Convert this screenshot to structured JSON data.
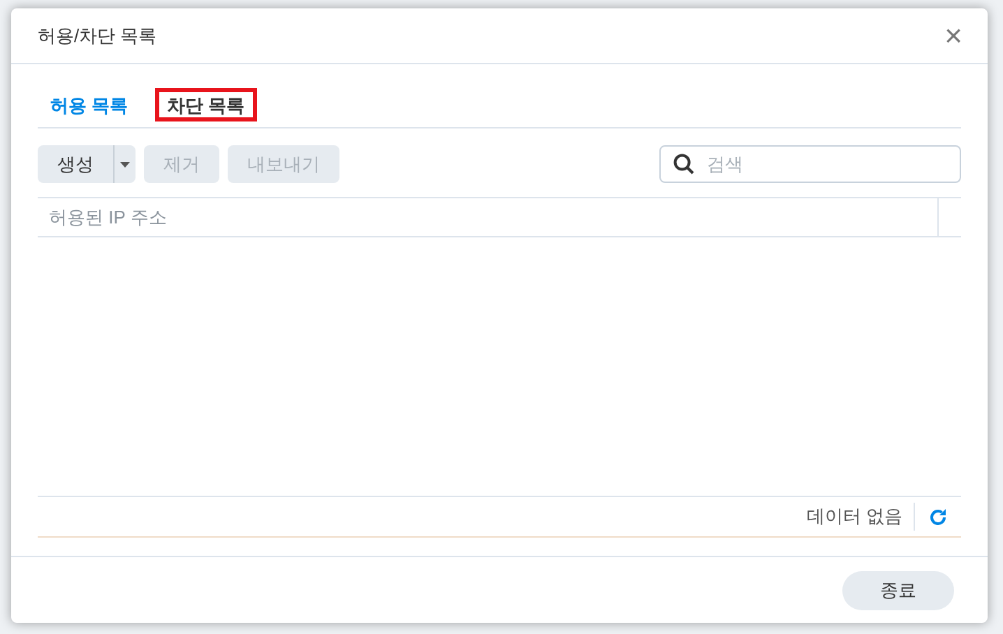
{
  "window": {
    "title": "허용/차단 목록",
    "close": "×"
  },
  "tabs": [
    {
      "label": "허용 목록",
      "selected": true,
      "highlighted": false
    },
    {
      "label": "차단 목록",
      "selected": false,
      "highlighted": true
    }
  ],
  "toolbar": {
    "buttons": [
      {
        "label": "생성",
        "disabled": false,
        "dropdown": true
      },
      {
        "label": "제거",
        "disabled": true,
        "dropdown": false
      },
      {
        "label": "내보내기",
        "disabled": true,
        "dropdown": false
      }
    ],
    "search": {
      "placeholder": "검색"
    }
  },
  "table": {
    "columns": [
      "허용된 IP 주소"
    ]
  },
  "status_bar": {
    "text": "데이터 없음"
  },
  "footer": {
    "buttons": [
      "종료"
    ]
  }
}
